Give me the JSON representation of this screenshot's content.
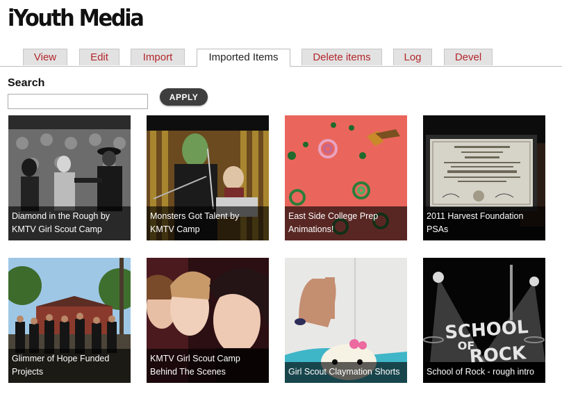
{
  "site": {
    "title": "iYouth Media"
  },
  "tabs": [
    {
      "label": "View"
    },
    {
      "label": "Edit"
    },
    {
      "label": "Import"
    },
    {
      "label": "Imported Items"
    },
    {
      "label": "Delete items"
    },
    {
      "label": "Log"
    },
    {
      "label": "Devel"
    }
  ],
  "search": {
    "label": "Search",
    "value": "",
    "placeholder": "",
    "button_label": "APPLY"
  },
  "items": [
    {
      "caption": "Diamond in the Rough by KMTV Girl Scout Camp"
    },
    {
      "caption": "Monsters Got Talent by KMTV Camp"
    },
    {
      "caption": "East Side College Prep Animations!"
    },
    {
      "caption": "2011 Harvest Foundation PSAs"
    },
    {
      "caption": "Glimmer of Hope Funded Projects"
    },
    {
      "caption": "KMTV Girl Scout Camp Behind The Scenes"
    },
    {
      "caption": "Girl Scout Claymation Shorts"
    },
    {
      "caption": "School of Rock - rough intro"
    }
  ],
  "thumbnail_art": {
    "school_of_rock_logo_text": [
      "SCHOOL",
      "OF",
      "ROCK"
    ]
  }
}
